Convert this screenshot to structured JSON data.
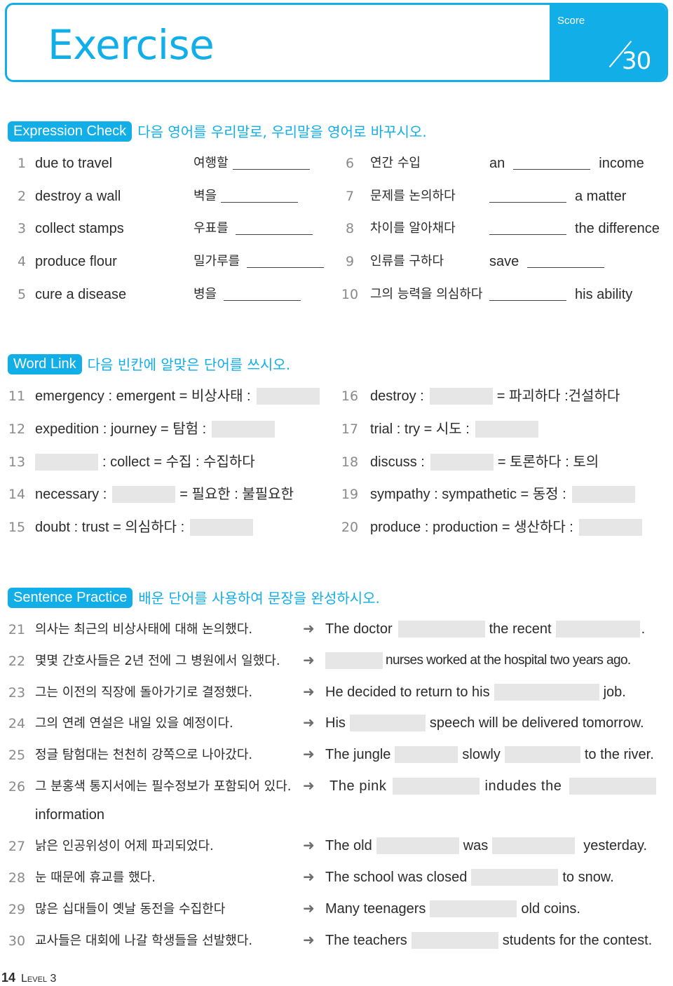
{
  "header": {
    "title": "Exercise",
    "score_label": "Score",
    "score_total": "30"
  },
  "colors": {
    "accent": "#12aee8",
    "blank_fill": "#e6e6e6",
    "number_gray": "#8a8a8a"
  },
  "expression_check": {
    "badge": "Expression Check",
    "instruction": "다음 영어를 우리말로, 우리말을 영어로 바꾸시오.",
    "left": [
      {
        "n": "1",
        "prompt": "due to travel",
        "answer_prefix": "여행할"
      },
      {
        "n": "2",
        "prompt": "destroy a wall",
        "answer_prefix": "벽을"
      },
      {
        "n": "3",
        "prompt": "collect stamps",
        "answer_prefix": "우표를"
      },
      {
        "n": "4",
        "prompt": "produce flour",
        "answer_prefix": "밀가루를"
      },
      {
        "n": "5",
        "prompt": "cure a disease",
        "answer_prefix": "병을"
      }
    ],
    "right": [
      {
        "n": "6",
        "prompt": "연간 수입",
        "before": "an",
        "after": "income"
      },
      {
        "n": "7",
        "prompt": "문제를 논의하다",
        "before": "",
        "after": "a matter"
      },
      {
        "n": "8",
        "prompt": "차이를 알아채다",
        "before": "",
        "after": "the difference"
      },
      {
        "n": "9",
        "prompt": "인류를 구하다",
        "before": "save",
        "after": ""
      },
      {
        "n": "10",
        "prompt": "그의 능력을 의심하다",
        "before": "",
        "after": "his ability"
      }
    ]
  },
  "word_link": {
    "badge": "Word Link",
    "instruction": "다음 빈칸에 알맞은 단어를 쓰시오.",
    "items": [
      {
        "n": "11",
        "a": "emergency : emergent = 비상사태 :",
        "b": ""
      },
      {
        "n": "12",
        "a": "expedition : journey = 탐험 :",
        "b": ""
      },
      {
        "n": "13",
        "a": "",
        "b": ": collect = 수집 : 수집하다"
      },
      {
        "n": "14",
        "a": "necessary :",
        "b": "= 필요한 : 불필요한"
      },
      {
        "n": "15",
        "a": "doubt : trust = 의심하다 :",
        "b": ""
      },
      {
        "n": "16",
        "a": "destroy :",
        "b": "= 파괴하다 :건설하다"
      },
      {
        "n": "17",
        "a": "trial : try = 시도 :",
        "b": ""
      },
      {
        "n": "18",
        "a": "discuss :",
        "b": "= 토론하다 : 토의"
      },
      {
        "n": "19",
        "a": "sympathy : sympathetic = 동정 :",
        "b": ""
      },
      {
        "n": "20",
        "a": "produce : production = 생산하다 :",
        "b": ""
      }
    ]
  },
  "sentence_practice": {
    "badge": "Sentence Practice",
    "instruction": "배운 단어를 사용하여 문장을 완성하시오.",
    "items": [
      {
        "n": "21",
        "ko": "의사는 최근의 비상사태에 대해 논의했다.",
        "en": [
          "The doctor",
          "the recent",
          "."
        ]
      },
      {
        "n": "22",
        "ko": "몇몇 간호사들은 2년 전에 그 병원에서 일했다.",
        "en": [
          "",
          "nurses worked at the hospital two years ago."
        ]
      },
      {
        "n": "23",
        "ko": "그는 이전의 직장에 돌아가기로 결정했다.",
        "en": [
          "He decided to return to his",
          "job."
        ]
      },
      {
        "n": "24",
        "ko": "그의 연례 연설은 내일 있을 예정이다.",
        "en": [
          "His",
          "speech will be delivered tomorrow."
        ]
      },
      {
        "n": "25",
        "ko": "정글 탐험대는 천천히 강쪽으로 나아갔다.",
        "en": [
          "The jungle",
          "slowly",
          "to the river."
        ]
      },
      {
        "n": "26",
        "ko": "그 분홍색 통지서에는 필수정보가 포함되어 있다.",
        "en": [
          "The pink",
          "indudes the",
          ""
        ],
        "continuation": "information"
      },
      {
        "n": "27",
        "ko": "낡은 인공위성이 어제 파괴되었다.",
        "en": [
          "The old",
          "was",
          "yesterday."
        ]
      },
      {
        "n": "28",
        "ko": "눈 때문에 휴교를 했다.",
        "en": [
          "The school was closed",
          "to snow."
        ]
      },
      {
        "n": "29",
        "ko": "많은 십대들이 옛날 동전을 수집한다",
        "en": [
          "Many teenagers",
          "old coins."
        ]
      },
      {
        "n": "30",
        "ko": "교사들은 대회에 나갈 학생들을 선발했다.",
        "en": [
          "The teachers",
          "students for the contest."
        ]
      }
    ]
  },
  "footer": {
    "page": "14",
    "level": "Level 3"
  }
}
